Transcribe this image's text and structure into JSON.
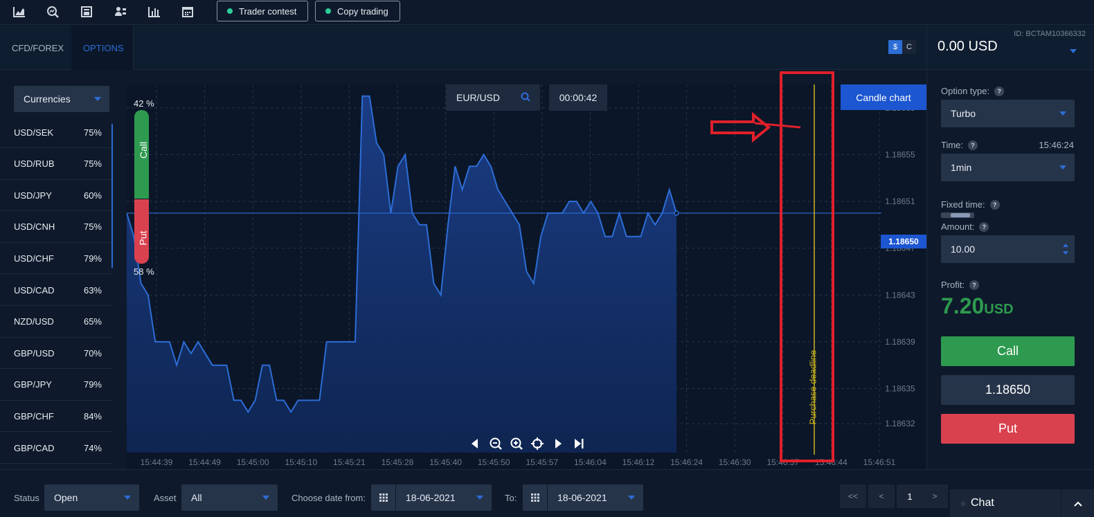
{
  "topbar": {
    "icons": [
      "line-chart-icon",
      "search-chart-icon",
      "book-icon",
      "user-tree-icon",
      "bar-chart-icon",
      "calendar-icon"
    ],
    "trader_contest": "Trader contest",
    "copy_trading": "Copy trading"
  },
  "subbar": {
    "tab_cfd": "CFD/FOREX",
    "tab_options": "OPTIONS",
    "currency_dollar": "$",
    "currency_c": "C",
    "account_id": "ID: BCTAM10366332",
    "balance": "0.00 USD"
  },
  "left_panel": {
    "category": "Currencies",
    "assets": [
      {
        "name": "USD/SEK",
        "pct": "75%"
      },
      {
        "name": "USD/RUB",
        "pct": "75%"
      },
      {
        "name": "USD/JPY",
        "pct": "60%"
      },
      {
        "name": "USD/CNH",
        "pct": "75%"
      },
      {
        "name": "USD/CHF",
        "pct": "79%"
      },
      {
        "name": "USD/CAD",
        "pct": "63%"
      },
      {
        "name": "NZD/USD",
        "pct": "65%"
      },
      {
        "name": "GBP/USD",
        "pct": "70%"
      },
      {
        "name": "GBP/JPY",
        "pct": "79%"
      },
      {
        "name": "GBP/CHF",
        "pct": "84%"
      },
      {
        "name": "GBP/CAD",
        "pct": "74%"
      }
    ]
  },
  "chart": {
    "pair": "EUR/USD",
    "timer": "00:00:42",
    "candle_button": "Candle chart",
    "call_pct": "42 %",
    "put_pct": "58 %",
    "call_label": "Call",
    "put_label": "Put",
    "deadline_label": "Purchase deadline",
    "current_price": "1.18650",
    "colors": {
      "line": "#2d6dd6",
      "deadline": "#c9b21e",
      "highlight": "#e0202a",
      "call": "#2e9a4f",
      "put": "#d9414f"
    }
  },
  "chart_data": {
    "type": "area",
    "x_ticks": [
      "15:44:39",
      "15:44:49",
      "15:45:00",
      "15:45:10",
      "15:45:21",
      "15:45:28",
      "15:45:40",
      "15:45:50",
      "15:45:57",
      "15:46:04",
      "15:46:12",
      "15:46:24",
      "15:46:30",
      "15:46:37",
      "15:46:44",
      "15:46:51"
    ],
    "y_ticks": [
      "1.18659",
      "1.18655",
      "1.18651",
      "1.18647",
      "1.18643",
      "1.18639",
      "1.18635",
      "1.18632"
    ],
    "ylim": [
      1.1863,
      1.18661
    ],
    "series": [
      {
        "values": [
          1.1865,
          1.18648,
          1.18644,
          1.18643,
          1.18639,
          1.18639,
          1.18639,
          1.18637,
          1.18639,
          1.18638,
          1.18639,
          1.18638,
          1.18637,
          1.18637,
          1.18637,
          1.18634,
          1.18634,
          1.18633,
          1.18634,
          1.18637,
          1.18637,
          1.18634,
          1.18634,
          1.18633,
          1.18634,
          1.18634,
          1.18634,
          1.18634,
          1.18639,
          1.18639,
          1.18639,
          1.18639,
          1.18639,
          1.1866,
          1.1866,
          1.18656,
          1.18655,
          1.1865,
          1.18654,
          1.18655,
          1.1865,
          1.18649,
          1.18649,
          1.18644,
          1.18643,
          1.18649,
          1.18654,
          1.18652,
          1.18654,
          1.18654,
          1.18655,
          1.18654,
          1.18652,
          1.18651,
          1.1865,
          1.18649,
          1.18645,
          1.18644,
          1.18648,
          1.1865,
          1.1865,
          1.1865,
          1.18651,
          1.18651,
          1.1865,
          1.18651,
          1.1865,
          1.18648,
          1.18648,
          1.1865,
          1.18648,
          1.18648,
          1.18648,
          1.1865,
          1.18649,
          1.1865,
          1.18652,
          1.1865
        ]
      }
    ]
  },
  "chart_controls": [
    "prev-icon",
    "zoom-out-icon",
    "zoom-in-icon",
    "crosshair-icon",
    "play-icon",
    "end-icon"
  ],
  "right_panel": {
    "option_type_label": "Option type:",
    "option_type": "Turbo",
    "time_label": "Time:",
    "clock": "15:46:24",
    "time_value": "1min",
    "fixed_time_label": "Fixed time:",
    "amount_label": "Amount:",
    "amount": "10.00",
    "profit_label": "Profit:",
    "profit_value": "7.20",
    "profit_unit": "USD",
    "call_button": "Call",
    "price": "1.18650",
    "put_button": "Put"
  },
  "bottom_bar": {
    "status_label": "Status",
    "status_value": "Open",
    "asset_label": "Asset",
    "asset_value": "All",
    "date_from_label": "Choose date from:",
    "date_from": "18-06-2021",
    "to_label": "To:",
    "date_to": "18-06-2021",
    "pager_first": "<<",
    "pager_prev": "<",
    "pager_page": "1",
    "pager_next": ">",
    "chat": "Chat"
  }
}
